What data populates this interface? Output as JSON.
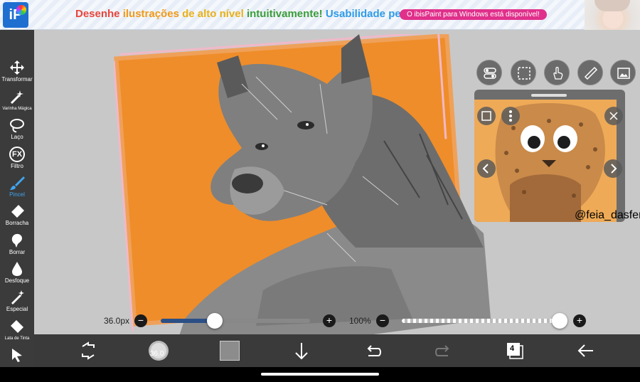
{
  "ad": {
    "logo_text": "iP",
    "headline_words": [
      "Desenhe",
      "ilustrações",
      "de alto nível",
      "intuitivamente!",
      "Usabilidade perfeita!"
    ],
    "pill_text": "O ibisPaint para Windows está disponível!"
  },
  "toolbar": {
    "items": [
      {
        "label": "Transformar",
        "icon": "move-icon"
      },
      {
        "label": "Varinha Mágica",
        "icon": "magic-wand-icon"
      },
      {
        "label": "Laço",
        "icon": "lasso-icon"
      },
      {
        "label": "Filtro",
        "icon": "fx-icon",
        "icon_text": "FX"
      },
      {
        "label": "Pincel",
        "icon": "brush-icon",
        "active": true
      },
      {
        "label": "Borracha",
        "icon": "eraser-icon"
      },
      {
        "label": "Borrar",
        "icon": "smudge-icon"
      },
      {
        "label": "Desfoque",
        "icon": "blur-icon"
      },
      {
        "label": "Especial",
        "icon": "special-pen-icon"
      },
      {
        "label": "Lata de Tinta",
        "icon": "paint-bucket-icon"
      },
      {
        "label": "",
        "icon": "select-arrow-icon"
      }
    ]
  },
  "sliders": {
    "size_label": "36.0px",
    "size_value": 0.36,
    "opacity_label": "100%",
    "opacity_value": 1.0
  },
  "bottombar": {
    "brush_size_badge": "36.0",
    "layer_count": "4"
  },
  "reference": {
    "caption": "@feia_dasferth"
  },
  "colors": {
    "accent": "#3fa5f0",
    "orange_bg": "#ef8d2a",
    "slider_fill": "#2c4f86"
  }
}
